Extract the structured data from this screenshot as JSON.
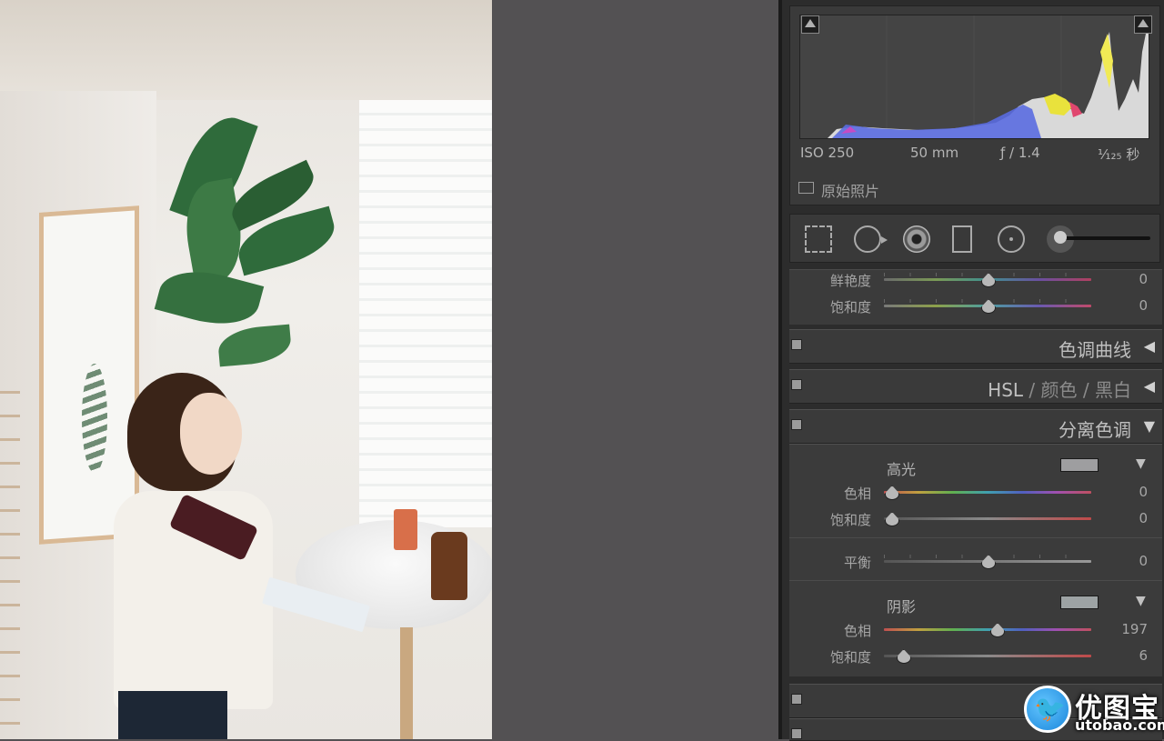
{
  "histogram": {
    "iso": "ISO 250",
    "focal": "50 mm",
    "aperture": "ƒ / 1.4",
    "shutter": "¹⁄₁₂₅ 秒",
    "original_photo_label": "原始照片"
  },
  "tools": {
    "icons": [
      "crop-overlay-icon",
      "spot-removal-icon",
      "red-eye-icon",
      "graduated-filter-icon",
      "radial-filter-icon",
      "adjustment-brush-icon"
    ]
  },
  "basic": {
    "vibrance": {
      "label": "鲜艳度",
      "value": "0",
      "position": 0.5
    },
    "saturation": {
      "label": "饱和度",
      "value": "0",
      "position": 0.5
    }
  },
  "sections": {
    "tone_curve": {
      "title": "色调曲线",
      "arrow": "◀"
    },
    "hsl": {
      "hsl": "HSL",
      "sep1": "/",
      "color": "颜色",
      "sep2": "/",
      "bw": "黑白",
      "arrow": "◀"
    },
    "split_toning": {
      "title": "分离色调",
      "arrow": "▼"
    }
  },
  "split": {
    "highlights": {
      "title": "高光",
      "swatch_color": "#9e9ea0",
      "arrow": "▼",
      "hue": {
        "label": "色相",
        "value": "0",
        "position": 0.0
      },
      "saturation": {
        "label": "饱和度",
        "value": "0",
        "position": 0.0
      }
    },
    "balance": {
      "label": "平衡",
      "value": "0",
      "position": 0.5
    },
    "shadows": {
      "title": "阴影",
      "swatch_color": "#9da3a4",
      "arrow": "▼",
      "hue": {
        "label": "色相",
        "value": "197",
        "position": 0.547
      },
      "saturation": {
        "label": "饱和度",
        "value": "6",
        "position": 0.06
      }
    }
  },
  "watermark": {
    "cn": "优图宝",
    "url": "utobao.com"
  },
  "colors": {
    "panel_bg": "#2c2c2c",
    "section_bg": "#3b3b3b",
    "workspace": "#535153"
  }
}
